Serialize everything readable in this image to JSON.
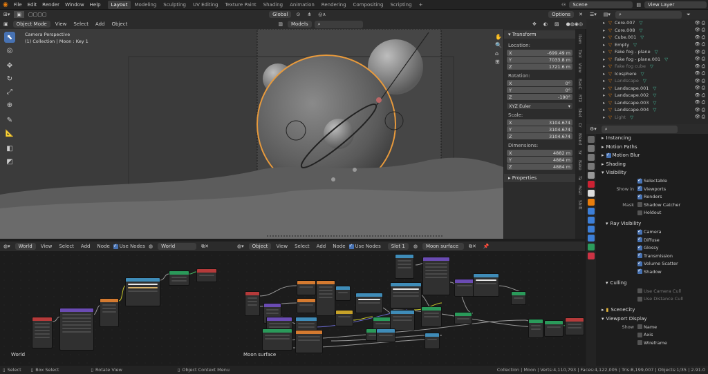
{
  "topbar": {
    "menus": [
      "File",
      "Edit",
      "Render",
      "Window",
      "Help"
    ],
    "workspaces": [
      "Layout",
      "Modeling",
      "Sculpting",
      "UV Editing",
      "Texture Paint",
      "Shading",
      "Animation",
      "Rendering",
      "Compositing",
      "Scripting"
    ],
    "active_workspace": "Layout",
    "scene": "Scene",
    "view_layer": "View Layer"
  },
  "viewport_header": {
    "mode": "Object Mode",
    "menus": [
      "View",
      "Select",
      "Add",
      "Object"
    ],
    "orientation": "Global",
    "options": "Options",
    "models": "Models"
  },
  "viewport": {
    "camera_label": "Camera Perspective",
    "collection_label": "(1) Collection | Moon : Key 1"
  },
  "npanel": {
    "title": "Transform",
    "location_label": "Location:",
    "location": [
      {
        "axis": "X",
        "value": "-699.49 m"
      },
      {
        "axis": "Y",
        "value": "7033.8 m"
      },
      {
        "axis": "Z",
        "value": "1721.6 m"
      }
    ],
    "rotation_label": "Rotation:",
    "rotation": [
      {
        "axis": "X",
        "value": "0°"
      },
      {
        "axis": "Y",
        "value": "0°"
      },
      {
        "axis": "Z",
        "value": "-190°"
      }
    ],
    "rotation_mode": "XYZ Euler",
    "scale_label": "Scale:",
    "scale": [
      {
        "axis": "X",
        "value": "3104.674"
      },
      {
        "axis": "Y",
        "value": "3104.674"
      },
      {
        "axis": "Z",
        "value": "3104.674"
      }
    ],
    "dimensions_label": "Dimensions:",
    "dimensions": [
      {
        "axis": "X",
        "value": "4882 m"
      },
      {
        "axis": "Y",
        "value": "4884 m"
      },
      {
        "axis": "Z",
        "value": "4884 m"
      }
    ],
    "properties": "Properties",
    "tabs": [
      "Item",
      "Tool",
      "View",
      "BaoC",
      "RTX",
      "Sket",
      "Cr",
      "Blend",
      "Sr",
      "Bake",
      "Ta",
      "Real",
      "Shift"
    ]
  },
  "outliner": {
    "rows": [
      {
        "name": "Core.007",
        "dim": false
      },
      {
        "name": "Core.008",
        "dim": false
      },
      {
        "name": "Cube.001",
        "dim": false
      },
      {
        "name": "Empty",
        "dim": false
      },
      {
        "name": "Fake fog - plane",
        "dim": false
      },
      {
        "name": "Fake fog - plane.001",
        "dim": false
      },
      {
        "name": "Fake fog cube",
        "dim": true
      },
      {
        "name": "Icosphere",
        "dim": false
      },
      {
        "name": "Landscape",
        "dim": true
      },
      {
        "name": "Landscape.001",
        "dim": false
      },
      {
        "name": "Landscape.002",
        "dim": false
      },
      {
        "name": "Landscape.003",
        "dim": false
      },
      {
        "name": "Landscape.004",
        "dim": false
      },
      {
        "name": "Light",
        "dim": true
      }
    ]
  },
  "properties": {
    "sections": {
      "instancing": "Instancing",
      "motion_paths": "Motion Paths",
      "motion_blur": "Motion Blur",
      "shading": "Shading",
      "visibility": "Visibility",
      "ray_visibility": "Ray Visibility",
      "culling": "Culling",
      "viewport_display": "Viewport Display"
    },
    "selectable": "Selectable",
    "show_in_label": "Show in",
    "viewports": "Viewports",
    "renders": "Renders",
    "mask_label": "Mask",
    "shadow_catcher": "Shadow Catcher",
    "holdout": "Holdout",
    "ray_items": [
      "Camera",
      "Diffuse",
      "Glossy",
      "Transmission",
      "Volume Scatter",
      "Shadow"
    ],
    "use_camera_cull": "Use Camera Cull",
    "use_distance_cull": "Use Distance Cull",
    "collection_name": "SceneCity",
    "show_label": "Show",
    "display_items": [
      "Name",
      "Axis",
      "Wireframe"
    ]
  },
  "node_left": {
    "type": "World",
    "menus": [
      "View",
      "Select",
      "Add",
      "Node"
    ],
    "use_nodes": "Use Nodes",
    "datablock": "World",
    "label": "World"
  },
  "node_right": {
    "type": "Object",
    "menus": [
      "View",
      "Select",
      "Add",
      "Node"
    ],
    "use_nodes": "Use Nodes",
    "slot": "Slot 1",
    "material": "Moon surface",
    "label": "Moon surface"
  },
  "statusbar": {
    "select": "Select",
    "box_select": "Box Select",
    "rotate_view": "Rotate View",
    "context_menu": "Object Context Menu",
    "stats": "Collection | Moon | Verts:4,110,793 | Faces:4,122,005 | Tris:8,199,007 | Objects:1/35 | 2.91.0"
  }
}
